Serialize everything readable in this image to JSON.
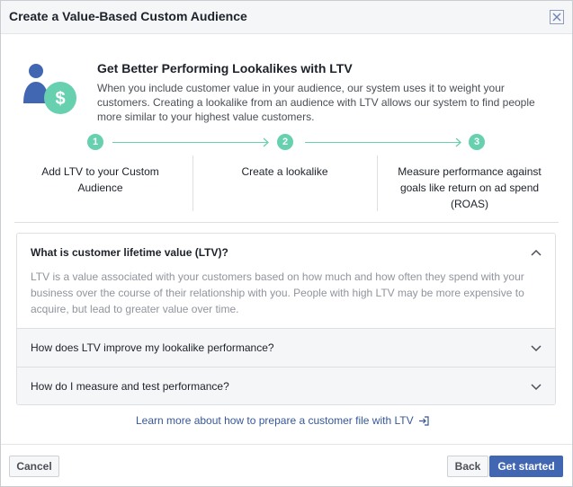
{
  "dialog": {
    "title": "Create a Value-Based Custom Audience"
  },
  "hero": {
    "title": "Get Better Performing Lookalikes with LTV",
    "description": "When you include customer value in your audience, our system uses it to weight your customers. Creating a lookalike from an audience with LTV allows our system to find people more similar to your highest value customers.",
    "icon": "person-with-dollar-icon"
  },
  "steps": [
    {
      "number": "1",
      "label": "Add LTV to your Custom Audience"
    },
    {
      "number": "2",
      "label": "Create a lookalike"
    },
    {
      "number": "3",
      "label": "Measure performance against goals like return on ad spend (ROAS)"
    }
  ],
  "faq": {
    "open_item": {
      "title": "What is customer lifetime value (LTV)?",
      "body": "LTV is a value associated with your customers based on how much and how often they spend with your business over the course of their relationship with you. People with high LTV may be more expensive to acquire, but lead to greater value over time."
    },
    "items": [
      {
        "title": "How does LTV improve my lookalike performance?"
      },
      {
        "title": "How do I measure and test performance?"
      }
    ]
  },
  "learn_more": {
    "label": "Learn more about how to prepare a customer file with LTV"
  },
  "footer": {
    "cancel_label": "Cancel",
    "back_label": "Back",
    "start_label": "Get started"
  },
  "colors": {
    "accent_green": "#67d0ae",
    "primary_blue": "#4267b2",
    "icon_blue": "#4267b2",
    "link_blue": "#365899"
  }
}
